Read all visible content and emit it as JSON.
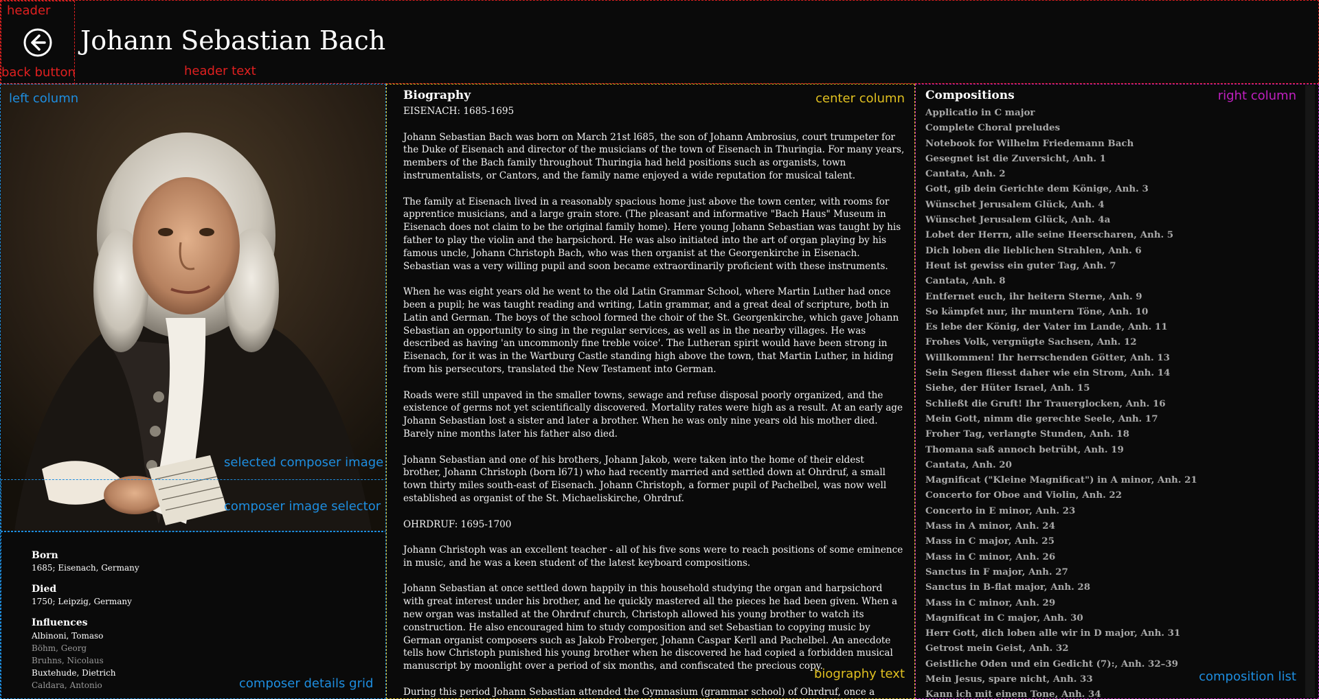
{
  "header": {
    "title": "Johann Sebastian Bach",
    "back_icon": "arrow-left-circle-icon"
  },
  "annotations": {
    "header": "header",
    "back_button": "back button",
    "header_text": "header text",
    "left_column": "left column",
    "center_column": "center column",
    "right_column": "right column",
    "selected_image": "selected composer image",
    "image_selector": "composer image  selector",
    "details_grid": "composer details grid",
    "biography_text": "biography text",
    "composition_list": "composition list"
  },
  "details": {
    "born_label": "Born",
    "born_value": "1685; Eisenach, Germany",
    "died_label": "Died",
    "died_value": "1750; Leipzig, Germany",
    "influences_label": "Influences",
    "influences": [
      {
        "name": "Albinoni, Tomaso",
        "dim": false
      },
      {
        "name": "Böhm, Georg",
        "dim": true
      },
      {
        "name": "Bruhns, Nicolaus",
        "dim": true
      },
      {
        "name": "Buxtehude, Dietrich",
        "dim": false
      },
      {
        "name": "Caldara, Antonio",
        "dim": true
      }
    ]
  },
  "biography": {
    "heading": "Biography",
    "paragraphs": [
      "EISENACH: 1685-1695",
      "Johann Sebastian Bach was born on March 21st l685, the son of Johann Ambrosius, court trumpeter for the Duke of Eisenach and director of the musicians of the town of Eisenach in Thuringia. For many years, members of the Bach family throughout Thuringia had held positions such as organists, town instrumentalists, or Cantors, and the family name enjoyed a wide reputation for musical talent.",
      "The family at Eisenach lived in a reasonably spacious home just above the town center, with rooms for apprentice musicians, and a large grain store. (The pleasant and informative \"Bach Haus\" Museum in Eisenach does not claim to be the original family home). Here young Johann Sebastian was taught by his father to play the violin and the harpsichord. He was also initiated into the art of organ playing by his famous uncle, Johann Christoph Bach, who was then organist at the Georgenkirche in Eisenach. Sebastian was a very willing pupil and soon became extraordinarily proficient with these instruments.",
      "When he was eight years old he went to the old Latin Grammar School, where Martin Luther had once been a pupil; he was taught reading and writing, Latin grammar, and a great deal of scripture, both in Latin and German. The boys of the school formed the choir of the St. Georgenkirche, which gave Johann Sebastian an opportunity to sing in the regular services, as well as in the nearby villages. He was described as having 'an uncommonly fine treble voice'. The Lutheran spirit would have been strong in Eisenach, for it was in the Wartburg Castle standing high above the town, that Martin Luther, in hiding from his persecutors, translated the New Testament into German.",
      "Roads were still unpaved in the smaller towns, sewage and refuse disposal poorly organized, and the existence of germs not yet scientifically discovered. Mortality rates were high as a result. At an early age Johann Sebastian lost a sister and later a brother. When he was only nine years old his mother died. Barely nine months later his father also died.",
      "Johann Sebastian and one of his brothers, Johann Jakob, were taken into the home of their eldest brother, Johann Christoph (born l671) who had recently married and settled down at Ohrdruf, a small town thirty miles south-east of Eisenach. Johann Christoph, a former pupil of Pachelbel, was now well established as organist of the St. Michaeliskirche, Ohrdruf.",
      "OHRDRUF: 1695-1700",
      "Johann Christoph was an excellent teacher - all of his five sons were to reach positions of some eminence in music, and he was a keen student of the latest keyboard compositions.",
      "Johann Sebastian at once settled down happily in this household studying the organ and harpsichord with great interest under his brother, and he quickly mastered all the pieces he had been given. When a new organ was installed at the Ohrdruf church, Christoph allowed his young brother to watch its construction. He also encouraged him to study composition and set Sebastian to copying music by German organist composers such as Jakob Froberger, Johann Caspar Kerll and Pachelbel. An anecdote tells how Christoph punished his young brother when he discovered he had copied a forbidden musical manuscript by moonlight over a period of six months, and confiscated the precious copy.",
      "During this period Johann Sebastian attended the Gymnasium (grammar school) of Ohrdruf, once a"
    ]
  },
  "compositions": {
    "heading": "Compositions",
    "items": [
      "Applicatio in C major",
      "Complete Choral preludes",
      "Notebook for Wilhelm Friedemann Bach",
      "Gesegnet ist die Zuversicht, Anh. 1",
      "Cantata, Anh. 2",
      "Gott, gib dein Gerichte dem Könige, Anh. 3",
      "Wünschet Jerusalem Glück, Anh. 4",
      "Wünschet Jerusalem Glück, Anh. 4a",
      "Lobet der Herrn, alle seine Heerscharen, Anh. 5",
      "Dich loben die lieblichen Strahlen, Anh. 6",
      "Heut ist gewiss ein guter Tag, Anh. 7",
      "Cantata, Anh. 8",
      "Entfernet euch, ihr heitern Sterne, Anh. 9",
      "So kämpfet nur, ihr muntern Töne, Anh. 10",
      "Es lebe der König, der Vater im Lande, Anh. 11",
      "Frohes Volk, vergnügte Sachsen, Anh. 12",
      "Willkommen! Ihr herrschenden Götter, Anh. 13",
      "Sein Segen fliesst daher wie ein Strom, Anh. 14",
      "Siehe, der Hüter Israel, Anh. 15",
      "Schließt die Gruft! Ihr Trauerglocken, Anh. 16",
      "Mein Gott, nimm die gerechte Seele, Anh. 17",
      "Froher Tag, verlangte Stunden, Anh. 18",
      "Thomana saß annoch betrübt, Anh. 19",
      "Cantata, Anh. 20",
      "Magnificat (\"Kleine Magnificat\") in A minor, Anh. 21",
      "Concerto for Oboe and Violin, Anh. 22",
      "Concerto in E minor, Anh. 23",
      "Mass in A minor, Anh. 24",
      "Mass in C major, Anh. 25",
      "Mass in C minor, Anh. 26",
      "Sanctus in F major, Anh. 27",
      "Sanctus in B-flat major, Anh. 28",
      "Mass in C minor, Anh. 29",
      "Magnificat in C major, Anh. 30",
      "Herr Gott, dich loben alle wir in D major, Anh. 31",
      "Getrost mein Geist, Anh. 32",
      "Geistliche Oden und ein Gedicht (7):, Anh. 32–39",
      "Mein Jesus, spare nicht, Anh. 33",
      "Kann ich mit einem Tone, Anh. 34"
    ]
  }
}
